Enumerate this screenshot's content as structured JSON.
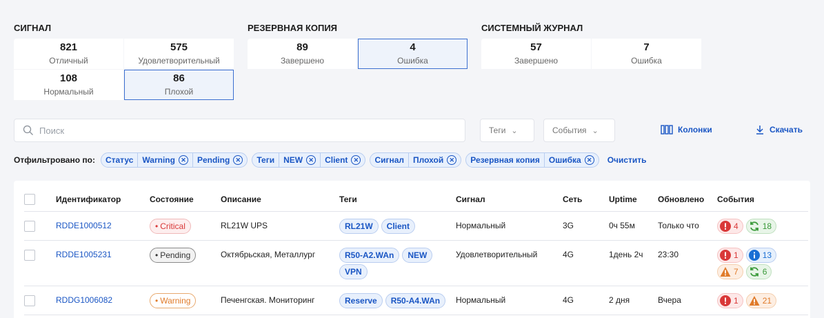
{
  "stat_groups": [
    {
      "title": "СИГНАЛ",
      "tiles": [
        {
          "value": "821",
          "label": "Отличный",
          "selected": false
        },
        {
          "value": "575",
          "label": "Удовлетворительный",
          "selected": false
        },
        {
          "value": "108",
          "label": "Нормальный",
          "selected": false
        },
        {
          "value": "86",
          "label": "Плохой",
          "selected": true
        }
      ]
    },
    {
      "title": "РЕЗЕРВНАЯ КОПИЯ",
      "tiles": [
        {
          "value": "89",
          "label": "Завершено",
          "selected": false
        },
        {
          "value": "4",
          "label": "Ошибка",
          "selected": true
        }
      ]
    },
    {
      "title": "СИСТЕМНЫЙ ЖУРНАЛ",
      "tiles": [
        {
          "value": "57",
          "label": "Завершено",
          "selected": false
        },
        {
          "value": "7",
          "label": "Ошибка",
          "selected": false
        }
      ]
    }
  ],
  "toolbar": {
    "search_placeholder": "Поиск",
    "tags_label": "Теги",
    "events_label": "События",
    "columns_label": "Колонки",
    "download_label": "Скачать"
  },
  "filters": {
    "label": "Отфильтровано по:",
    "groups": [
      {
        "name": "Статус",
        "values": [
          "Warning",
          "Pending"
        ]
      },
      {
        "name": "Теги",
        "values": [
          "NEW",
          "Client"
        ]
      },
      {
        "name": "Сигнал",
        "values": [
          "Плохой"
        ]
      },
      {
        "name": "Резервная копия",
        "values": [
          "Ошибка"
        ]
      }
    ],
    "clear_label": "Очистить"
  },
  "table": {
    "columns": [
      "Идентификатор",
      "Состояние",
      "Описание",
      "Теги",
      "Сигнал",
      "Сеть",
      "Uptime",
      "Обновлено",
      "События"
    ],
    "rows": [
      {
        "id": "RDDE1000512",
        "state": "Critical",
        "state_kind": "critical",
        "description": "RL21W UPS",
        "tags": [
          "RL21W",
          "Client"
        ],
        "signal": "Нормальный",
        "network": "3G",
        "uptime": "0ч 55м",
        "updated": "Только что",
        "events": [
          {
            "kind": "error",
            "count": "4"
          },
          {
            "kind": "sync",
            "count": "18"
          }
        ]
      },
      {
        "id": "RDDE1005231",
        "state": "Pending",
        "state_kind": "pending",
        "description": "Октябрьская, Металлург",
        "tags": [
          "R50-A2.WAn",
          "NEW",
          "VPN"
        ],
        "signal": "Удовлетворительный",
        "network": "4G",
        "uptime": "1день 2ч",
        "updated": "23:30",
        "events": [
          {
            "kind": "error",
            "count": "1"
          },
          {
            "kind": "info",
            "count": "13"
          },
          {
            "kind": "warning",
            "count": "7"
          },
          {
            "kind": "sync",
            "count": "6"
          }
        ]
      },
      {
        "id": "RDDG1006082",
        "state": "Warning",
        "state_kind": "warning",
        "description": "Печенгская. Мониторинг",
        "tags": [
          "Reserve",
          "R50-A4.WAn"
        ],
        "signal": "Нормальный",
        "network": "4G",
        "uptime": "2 дня",
        "updated": "Вчера",
        "events": [
          {
            "kind": "error",
            "count": "1"
          },
          {
            "kind": "warning",
            "count": "21"
          }
        ]
      }
    ]
  },
  "colors": {
    "accent": "#1a56c4",
    "critical": "#d93838",
    "warning": "#e07b2a",
    "pending": "#555555",
    "success": "#3a9a3a",
    "info": "#1a6fd4"
  }
}
